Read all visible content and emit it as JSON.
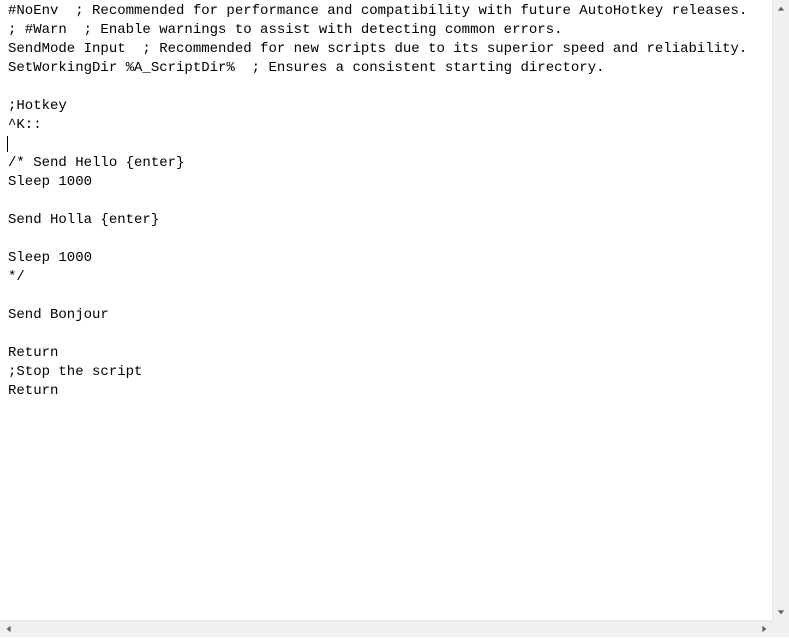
{
  "editor": {
    "lines": [
      "#NoEnv  ; Recommended for performance and compatibility with future AutoHotkey releases.",
      "; #Warn  ; Enable warnings to assist with detecting common errors.",
      "SendMode Input  ; Recommended for new scripts due to its superior speed and reliability.",
      "SetWorkingDir %A_ScriptDir%  ; Ensures a consistent starting directory.",
      "",
      ";Hotkey",
      "^K::",
      "",
      "/* Send Hello {enter}",
      "Sleep 1000",
      "",
      "Send Holla {enter}",
      "",
      "Sleep 1000",
      "*/",
      "",
      "Send Bonjour",
      "",
      "Return",
      ";Stop the script",
      "Return"
    ],
    "cursor_line": 7
  }
}
